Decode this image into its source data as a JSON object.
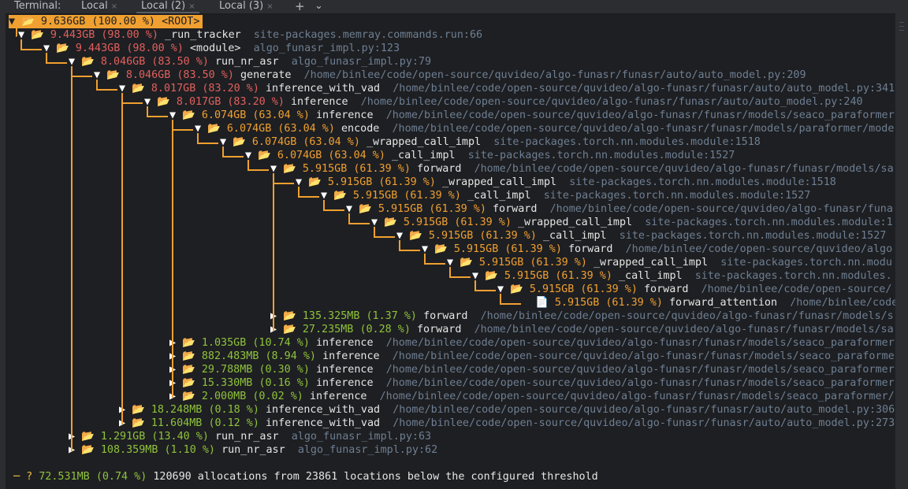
{
  "window": {
    "terminal_label": "Terminal:",
    "tabs": [
      {
        "label": "Local",
        "close": "×"
      },
      {
        "label": "Local (2)",
        "close": "×"
      },
      {
        "label": "Local (3)",
        "close": "×"
      }
    ],
    "add_tab": "+",
    "more_tabs": "⌄"
  },
  "root": {
    "arrow": "▼",
    "icon": "📂",
    "size": "9.636GB",
    "pct": "(100.00 %)",
    "name": "<ROOT>"
  },
  "rows": [
    {
      "arrow": "▼",
      "icon": "📂",
      "size": "9.443GB",
      "pct": "(98.00 %)",
      "name": "_run_tracker",
      "loc": "site-packages.memray.commands.run:66"
    },
    {
      "arrow": "▼",
      "icon": "📂",
      "size": "9.443GB",
      "pct": "(98.00 %)",
      "name": "<module>",
      "loc": "algo_funasr_impl.py:123"
    },
    {
      "arrow": "▼",
      "icon": "📂",
      "size": "8.046GB",
      "pct": "(83.50 %)",
      "name": "run_nr_asr",
      "loc": "algo_funasr_impl.py:79"
    },
    {
      "arrow": "▼",
      "icon": "📂",
      "size": "8.046GB",
      "pct": "(83.50 %)",
      "name": "generate",
      "loc": "/home/binlee/code/open-source/quvideo/algo-funasr/funasr/auto/auto_model.py:209"
    },
    {
      "arrow": "▼",
      "icon": "📂",
      "size": "8.017GB",
      "pct": "(83.20 %)",
      "name": "inference_with_vad",
      "loc": "/home/binlee/code/open-source/quvideo/algo-funasr/funasr/auto/auto_model.py:341"
    },
    {
      "arrow": "▼",
      "icon": "📂",
      "size": "8.017GB",
      "pct": "(83.20 %)",
      "name": "inference",
      "loc": "/home/binlee/code/open-source/quvideo/algo-funasr/funasr/auto/auto_model.py:240"
    },
    {
      "arrow": "▼",
      "icon": "📂",
      "size": "6.074GB",
      "pct": "(63.04 %)",
      "name": "inference",
      "loc": "/home/binlee/code/open-source/quvideo/algo-funasr/funasr/models/seaco_paraformer"
    },
    {
      "arrow": "▼",
      "icon": "📂",
      "size": "6.074GB",
      "pct": "(63.04 %)",
      "name": "encode",
      "loc": "/home/binlee/code/open-source/quvideo/algo-funasr/funasr/models/paraformer/mode"
    },
    {
      "arrow": "▼",
      "icon": "📂",
      "size": "6.074GB",
      "pct": "(63.04 %)",
      "name": "_wrapped_call_impl",
      "loc": "site-packages.torch.nn.modules.module:1518"
    },
    {
      "arrow": "▼",
      "icon": "📂",
      "size": "6.074GB",
      "pct": "(63.04 %)",
      "name": "_call_impl",
      "loc": "site-packages.torch.nn.modules.module:1527"
    },
    {
      "arrow": "▼",
      "icon": "📂",
      "size": "5.915GB",
      "pct": "(61.39 %)",
      "name": "forward",
      "loc": "/home/binlee/code/open-source/quvideo/algo-funasr/funasr/models/sa"
    },
    {
      "arrow": "▼",
      "icon": "📂",
      "size": "5.915GB",
      "pct": "(61.39 %)",
      "name": "_wrapped_call_impl",
      "loc": "site-packages.torch.nn.modules.module:1518"
    },
    {
      "arrow": "▼",
      "icon": "📂",
      "size": "5.915GB",
      "pct": "(61.39 %)",
      "name": "_call_impl",
      "loc": "site-packages.torch.nn.modules.module:1527"
    },
    {
      "arrow": "▼",
      "icon": "📂",
      "size": "5.915GB",
      "pct": "(61.39 %)",
      "name": "forward",
      "loc": "/home/binlee/code/open-source/quvideo/algo-funasr/funa"
    },
    {
      "arrow": "▼",
      "icon": "📂",
      "size": "5.915GB",
      "pct": "(61.39 %)",
      "name": "_wrapped_call_impl",
      "loc": "site-packages.torch.nn.modules.module:1"
    },
    {
      "arrow": "▼",
      "icon": "📂",
      "size": "5.915GB",
      "pct": "(61.39 %)",
      "name": "_call_impl",
      "loc": "site-packages.torch.nn.modules.module:1527"
    },
    {
      "arrow": "▼",
      "icon": "📂",
      "size": "5.915GB",
      "pct": "(61.39 %)",
      "name": "forward",
      "loc": "/home/binlee/code/open-source/quvideo/algo"
    },
    {
      "arrow": "▼",
      "icon": "📂",
      "size": "5.915GB",
      "pct": "(61.39 %)",
      "name": "_wrapped_call_impl",
      "loc": "site-packages.torch.nn.modu"
    },
    {
      "arrow": "▼",
      "icon": "📂",
      "size": "5.915GB",
      "pct": "(61.39 %)",
      "name": "_call_impl",
      "loc": "site-packages.torch.nn.modules."
    },
    {
      "arrow": "▼",
      "icon": "📂",
      "size": "5.915GB",
      "pct": "(61.39 %)",
      "name": "forward",
      "loc": "/home/binlee/code/open-source/"
    },
    {
      "arrow": "",
      "icon": "📄",
      "size": "5.915GB",
      "pct": "(61.39 %)",
      "name": "forward_attention",
      "loc": "/home/binlee/code/"
    },
    {
      "arrow": "▶",
      "icon": "📂",
      "size": "135.325MB",
      "pct": "(1.37 %)",
      "name": "forward",
      "loc": "/home/binlee/code/open-source/quvideo/algo-funasr/funasr/models/s"
    },
    {
      "arrow": "▶",
      "icon": "📂",
      "size": "27.235MB",
      "pct": "(0.28 %)",
      "name": "forward",
      "loc": "/home/binlee/code/open-source/quvideo/algo-funasr/funasr/models/sa"
    },
    {
      "arrow": "▶",
      "icon": "📂",
      "size": "1.035GB",
      "pct": "(10.74 %)",
      "name": "inference",
      "loc": "/home/binlee/code/open-source/quvideo/algo-funasr/funasr/models/seaco_paraformer"
    },
    {
      "arrow": "▶",
      "icon": "📂",
      "size": "882.483MB",
      "pct": "(8.94 %)",
      "name": "inference",
      "loc": "/home/binlee/code/open-source/quvideo/algo-funasr/funasr/models/seaco_paraforme"
    },
    {
      "arrow": "▶",
      "icon": "📂",
      "size": "29.788MB",
      "pct": "(0.30 %)",
      "name": "inference",
      "loc": "/home/binlee/code/open-source/quvideo/algo-funasr/funasr/models/seaco_paraformer"
    },
    {
      "arrow": "▶",
      "icon": "📂",
      "size": "15.330MB",
      "pct": "(0.16 %)",
      "name": "inference",
      "loc": "/home/binlee/code/open-source/quvideo/algo-funasr/funasr/models/seaco_paraformer"
    },
    {
      "arrow": "▶",
      "icon": "📂",
      "size": "2.000MB",
      "pct": "(0.02 %)",
      "name": "inference",
      "loc": "/home/binlee/code/open-source/quvideo/algo-funasr/funasr/models/seaco_paraformer/"
    },
    {
      "arrow": "▶",
      "icon": "📂",
      "size": "18.248MB",
      "pct": "(0.18 %)",
      "name": "inference_with_vad",
      "loc": "/home/binlee/code/open-source/quvideo/algo-funasr/funasr/auto/auto_model.py:306"
    },
    {
      "arrow": "▶",
      "icon": "📂",
      "size": "11.604MB",
      "pct": "(0.12 %)",
      "name": "inference_with_vad",
      "loc": "/home/binlee/code/open-source/quvideo/algo-funasr/funasr/auto/auto_model.py:273"
    },
    {
      "arrow": "▶",
      "icon": "📂",
      "size": "1.291GB",
      "pct": "(13.40 %)",
      "name": "run_nr_asr",
      "loc": "algo_funasr_impl.py:63"
    },
    {
      "arrow": "▶",
      "icon": "📂",
      "size": "108.359MB",
      "pct": "(1.10 %)",
      "name": "run_nr_asr",
      "loc": "algo_funasr_impl.py:62"
    }
  ],
  "threshold": {
    "marker": "?",
    "size": "72.531MB",
    "pct": "(0.74 %)",
    "text": "120690 allocations from 23861 locations below the configured threshold"
  },
  "colors": {
    "high": "#e0605e",
    "mid": "#f0a030",
    "low": "#8fc33c",
    "tree": "#f0a030",
    "location": "#6e7f93",
    "background": "#1e1f22"
  }
}
